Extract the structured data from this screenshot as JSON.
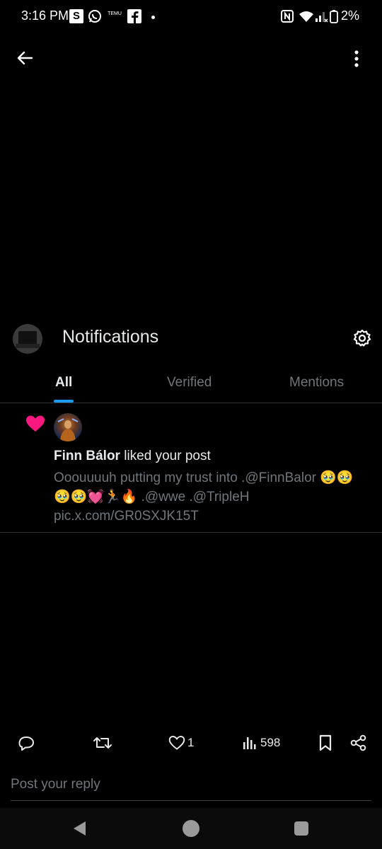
{
  "status_bar": {
    "time": "3:16 PM",
    "s_badge": "S",
    "temu_label": "TEMU",
    "battery": "2%"
  },
  "header": {
    "title": "Notifications"
  },
  "tabs": [
    {
      "label": "All",
      "active": true
    },
    {
      "label": "Verified",
      "active": false
    },
    {
      "label": "Mentions",
      "active": false
    }
  ],
  "notification": {
    "type": "like",
    "user_name": "Finn Bálor",
    "action_text": " liked your post",
    "post_text": "Ooouuuuh putting my trust into .@FinnBalor 🥹🥹🥹🥹💓🏃🔥 .@wwe .@TripleH pic.x.com/GR0SXJK15T"
  },
  "actions": {
    "like_count": "1",
    "view_count": "598"
  },
  "reply": {
    "placeholder": "Post your reply"
  },
  "colors": {
    "accent": "#1d9bf0",
    "like": "#f91880",
    "muted": "#71767b"
  }
}
